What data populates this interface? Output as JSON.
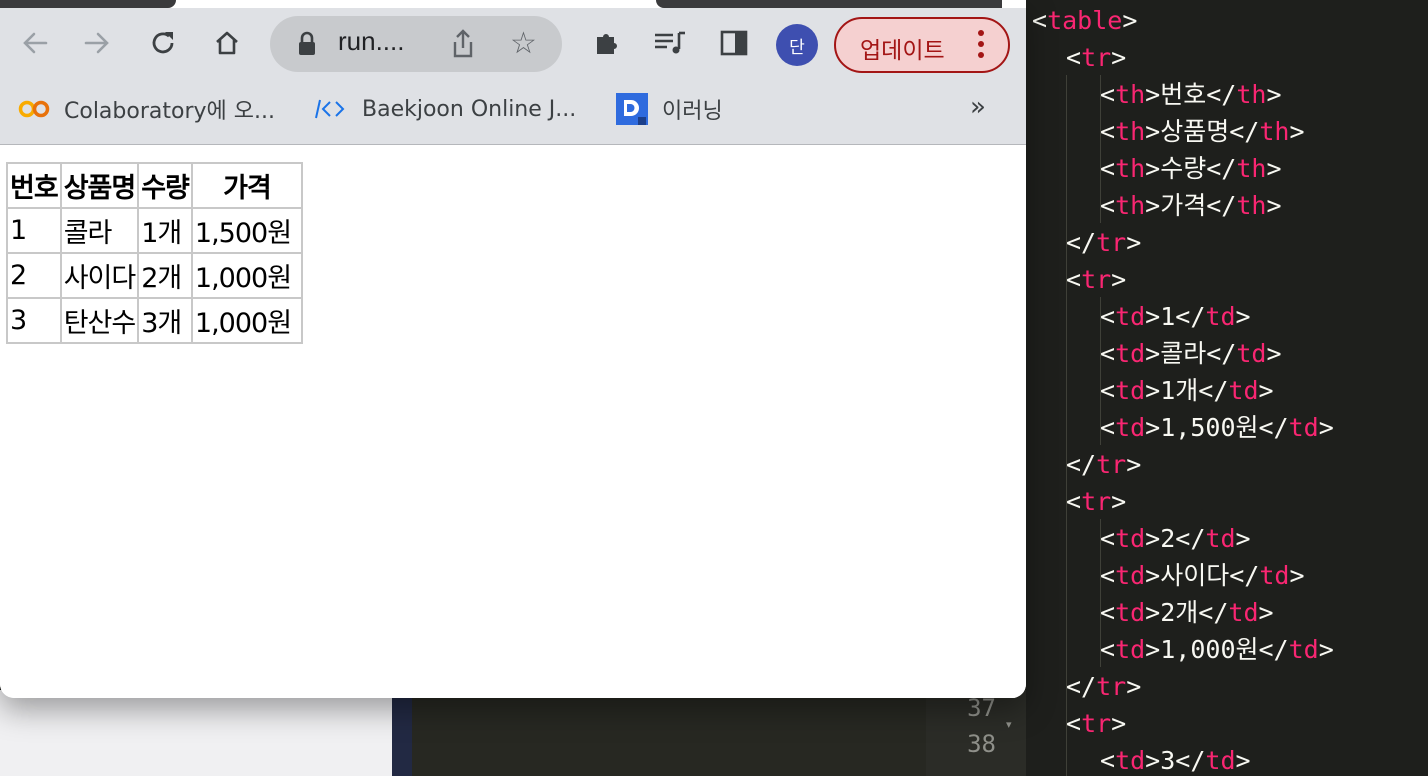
{
  "browser": {
    "url_text": "run....",
    "avatar_letter": "단",
    "update_label": "업데이트",
    "bookmarks": [
      {
        "label": "Colaboratory에 오..."
      },
      {
        "label": "Baekjoon Online J..."
      },
      {
        "label": "이러닝"
      }
    ],
    "bookmarks_overflow": "»",
    "icons": {
      "back": "arrow-left-icon",
      "forward": "arrow-right-icon",
      "reload": "reload-icon",
      "home": "home-icon",
      "lock": "lock-icon",
      "share": "share-icon",
      "star": "star-icon",
      "extensions": "puzzle-icon",
      "media": "media-queue-icon",
      "side_panel": "side-panel-icon",
      "menu": "vertical-dots-icon"
    }
  },
  "table": {
    "headers": [
      "번호",
      "상품명",
      "수량",
      "가격"
    ],
    "rows": [
      [
        "1",
        "콜라",
        "1개",
        "1,500원"
      ],
      [
        "2",
        "사이다",
        "2개",
        "1,000원"
      ],
      [
        "3",
        "탄산수",
        "3개",
        "1,000원"
      ]
    ]
  },
  "editor": {
    "line_numbers": [
      "37",
      "38"
    ],
    "lines": [
      {
        "indent": 0,
        "tag": "table",
        "close": false,
        "text": ""
      },
      {
        "indent": 1,
        "tag": "tr",
        "close": false,
        "text": ""
      },
      {
        "indent": 2,
        "tag": "th",
        "close": true,
        "text": "번호"
      },
      {
        "indent": 2,
        "tag": "th",
        "close": true,
        "text": "상품명"
      },
      {
        "indent": 2,
        "tag": "th",
        "close": true,
        "text": "수량"
      },
      {
        "indent": 2,
        "tag": "th",
        "close": true,
        "text": "가격"
      },
      {
        "indent": 1,
        "tag": "/tr",
        "close": false,
        "text": ""
      },
      {
        "indent": 1,
        "tag": "tr",
        "close": false,
        "text": ""
      },
      {
        "indent": 2,
        "tag": "td",
        "close": true,
        "text": "1"
      },
      {
        "indent": 2,
        "tag": "td",
        "close": true,
        "text": "콜라"
      },
      {
        "indent": 2,
        "tag": "td",
        "close": true,
        "text": "1개"
      },
      {
        "indent": 2,
        "tag": "td",
        "close": true,
        "text": "1,500원"
      },
      {
        "indent": 1,
        "tag": "/tr",
        "close": false,
        "text": ""
      },
      {
        "indent": 1,
        "tag": "tr",
        "close": false,
        "text": ""
      },
      {
        "indent": 2,
        "tag": "td",
        "close": true,
        "text": "2"
      },
      {
        "indent": 2,
        "tag": "td",
        "close": true,
        "text": "사이다"
      },
      {
        "indent": 2,
        "tag": "td",
        "close": true,
        "text": "2개"
      },
      {
        "indent": 2,
        "tag": "td",
        "close": true,
        "text": "1,000원"
      },
      {
        "indent": 1,
        "tag": "/tr",
        "close": false,
        "text": ""
      },
      {
        "indent": 1,
        "tag": "tr",
        "close": false,
        "text": ""
      },
      {
        "indent": 2,
        "tag": "td",
        "close": true,
        "text": "3"
      }
    ]
  },
  "colors": {
    "tag": "#f92672",
    "editor_bg": "#1e1f1c",
    "update_accent": "#a31515",
    "avatar_bg": "#3e4fb0"
  }
}
